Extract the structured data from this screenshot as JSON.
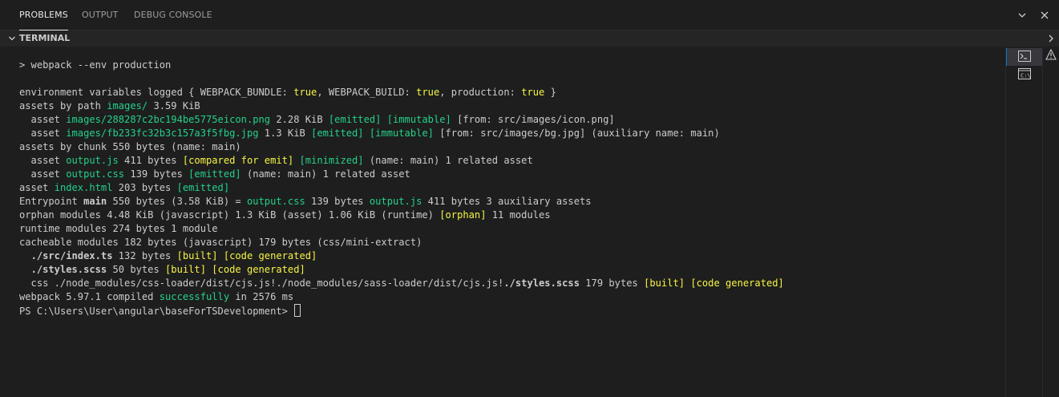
{
  "panel_tabs": {
    "problems": "PROBLEMS",
    "output": "OUTPUT",
    "debug_console": "DEBUG CONSOLE"
  },
  "terminal_header": {
    "title": "TERMINAL"
  },
  "colors": {
    "green": "#23d18b",
    "yellow": "#f5f543",
    "text": "#cccccc",
    "background": "#1e1e1e"
  },
  "terminal": {
    "lines": [
      [
        {
          "t": "> webpack --env production"
        }
      ],
      [],
      [
        {
          "t": "environment variables logged { WEBPACK_BUNDLE: "
        },
        {
          "t": "true",
          "c": "y"
        },
        {
          "t": ", WEBPACK_BUILD: "
        },
        {
          "t": "true",
          "c": "y"
        },
        {
          "t": ", production: "
        },
        {
          "t": "true",
          "c": "y"
        },
        {
          "t": " }"
        }
      ],
      [
        {
          "t": "assets by path "
        },
        {
          "t": "images/",
          "c": "g"
        },
        {
          "t": " 3.59 KiB"
        }
      ],
      [
        {
          "t": "  asset "
        },
        {
          "t": "images/288287c2bc194be5775eicon.png",
          "c": "g"
        },
        {
          "t": " 2.28 KiB "
        },
        {
          "t": "[emitted]",
          "c": "g"
        },
        {
          "t": " "
        },
        {
          "t": "[immutable]",
          "c": "g"
        },
        {
          "t": " [from: src/images/icon.png]"
        }
      ],
      [
        {
          "t": "  asset "
        },
        {
          "t": "images/fb233fc32b3c157a3f5fbg.jpg",
          "c": "g"
        },
        {
          "t": " 1.3 KiB "
        },
        {
          "t": "[emitted]",
          "c": "g"
        },
        {
          "t": " "
        },
        {
          "t": "[immutable]",
          "c": "g"
        },
        {
          "t": " [from: src/images/bg.jpg] (auxiliary name: main)"
        }
      ],
      [
        {
          "t": "assets by chunk 550 bytes (name: main)"
        }
      ],
      [
        {
          "t": "  asset "
        },
        {
          "t": "output.js",
          "c": "g"
        },
        {
          "t": " 411 bytes "
        },
        {
          "t": "[compared for emit]",
          "c": "y"
        },
        {
          "t": " "
        },
        {
          "t": "[minimized]",
          "c": "g"
        },
        {
          "t": " (name: main) 1 related asset"
        }
      ],
      [
        {
          "t": "  asset "
        },
        {
          "t": "output.css",
          "c": "g"
        },
        {
          "t": " 139 bytes "
        },
        {
          "t": "[emitted]",
          "c": "g"
        },
        {
          "t": " (name: main) 1 related asset"
        }
      ],
      [
        {
          "t": "asset "
        },
        {
          "t": "index.html",
          "c": "g"
        },
        {
          "t": " 203 bytes "
        },
        {
          "t": "[emitted]",
          "c": "g"
        }
      ],
      [
        {
          "t": "Entrypoint "
        },
        {
          "t": "main",
          "c": "b"
        },
        {
          "t": " 550 bytes (3.58 KiB) = "
        },
        {
          "t": "output.css",
          "c": "g"
        },
        {
          "t": " 139 bytes "
        },
        {
          "t": "output.js",
          "c": "g"
        },
        {
          "t": " 411 bytes 3 auxiliary assets"
        }
      ],
      [
        {
          "t": "orphan modules 4.48 KiB (javascript) 1.3 KiB (asset) 1.06 KiB (runtime) "
        },
        {
          "t": "[orphan]",
          "c": "y"
        },
        {
          "t": " 11 modules"
        }
      ],
      [
        {
          "t": "runtime modules 274 bytes 1 module"
        }
      ],
      [
        {
          "t": "cacheable modules 182 bytes (javascript) 179 bytes (css/mini-extract)"
        }
      ],
      [
        {
          "t": "  "
        },
        {
          "t": "./src/index.ts",
          "c": "b"
        },
        {
          "t": " 132 bytes "
        },
        {
          "t": "[built]",
          "c": "y"
        },
        {
          "t": " "
        },
        {
          "t": "[code generated]",
          "c": "y"
        }
      ],
      [
        {
          "t": "  "
        },
        {
          "t": "./styles.scss",
          "c": "b"
        },
        {
          "t": " 50 bytes "
        },
        {
          "t": "[built]",
          "c": "y"
        },
        {
          "t": " "
        },
        {
          "t": "[code generated]",
          "c": "y"
        }
      ],
      [
        {
          "t": "  css ./node_modules/css-loader/dist/cjs.js!./node_modules/sass-loader/dist/cjs.js!"
        },
        {
          "t": "./styles.scss",
          "c": "b"
        },
        {
          "t": " 179 bytes "
        },
        {
          "t": "[built]",
          "c": "y"
        },
        {
          "t": " "
        },
        {
          "t": "[code generated]",
          "c": "y"
        }
      ],
      [
        {
          "t": "webpack 5.97.1 compiled "
        },
        {
          "t": "successfully",
          "c": "g"
        },
        {
          "t": " in 2576 ms"
        }
      ],
      [
        {
          "t": "PS C:\\Users\\User\\angular\\baseForTSDevelopment> "
        }
      ]
    ]
  },
  "icons": {
    "chevron_down": "chevron-down-icon",
    "close": "close-icon",
    "collapse": "chevron-down-icon",
    "terminal_powershell": "terminal-icon",
    "terminal_cmd": "cmd-icon",
    "warning": "warning-icon",
    "chevron_right": "chevron-right-icon"
  }
}
